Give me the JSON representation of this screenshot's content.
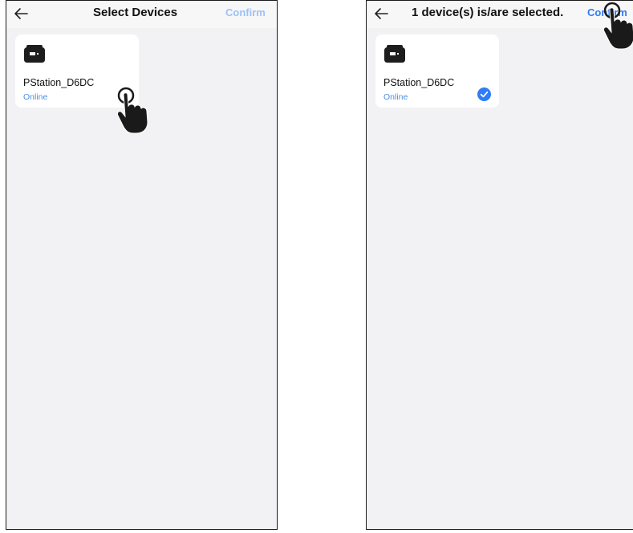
{
  "colors": {
    "accent": "#2f7cf6",
    "confirm_disabled": "#9cc2f5",
    "online": "#4a90e2",
    "screen_bg": "#f2f2f4",
    "card_bg": "#ffffff"
  },
  "left_screen": {
    "nav": {
      "back_icon": "arrow-left-icon",
      "title": "Select Devices",
      "confirm_label": "Confirm",
      "confirm_enabled": false
    },
    "devices": [
      {
        "icon": "power-station-icon",
        "name": "PStation_D6DC",
        "status": "Online",
        "selected": false
      }
    ],
    "pointer": "hand-pointer-icon"
  },
  "right_screen": {
    "nav": {
      "back_icon": "arrow-left-icon",
      "title": "1 device(s) is/are selected.",
      "confirm_label": "Confirm",
      "confirm_enabled": true
    },
    "devices": [
      {
        "icon": "power-station-icon",
        "name": "PStation_D6DC",
        "status": "Online",
        "selected": true
      }
    ],
    "pointer": "hand-pointer-icon"
  }
}
